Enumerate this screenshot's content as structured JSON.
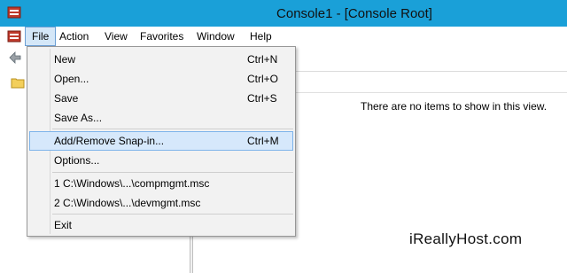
{
  "window": {
    "title": "Console1 - [Console Root]"
  },
  "menubar": [
    "File",
    "Action",
    "View",
    "Favorites",
    "Window",
    "Help"
  ],
  "file_menu": {
    "items": [
      {
        "label": "New",
        "shortcut": "Ctrl+N"
      },
      {
        "label": "Open...",
        "shortcut": "Ctrl+O"
      },
      {
        "label": "Save",
        "shortcut": "Ctrl+S"
      },
      {
        "label": "Save As...",
        "shortcut": ""
      },
      {
        "label": "Add/Remove Snap-in...",
        "shortcut": "Ctrl+M",
        "highlighted": true
      },
      {
        "label": "Options...",
        "shortcut": ""
      },
      {
        "label": "1 C:\\Windows\\...\\compmgmt.msc",
        "shortcut": ""
      },
      {
        "label": "2 C:\\Windows\\...\\devmgmt.msc",
        "shortcut": ""
      },
      {
        "label": "Exit",
        "shortcut": ""
      }
    ]
  },
  "content": {
    "empty_message": "There are no items to show in this view."
  },
  "watermark": "iReallyHost.com",
  "colors": {
    "titlebar": "#1aa0d8",
    "highlight": "#d6e8fb",
    "highlight_border": "#7eb4ea"
  },
  "icons": {
    "app": "mmc-console-icon",
    "back": "back-arrow-icon",
    "tree": "folder-icon"
  }
}
